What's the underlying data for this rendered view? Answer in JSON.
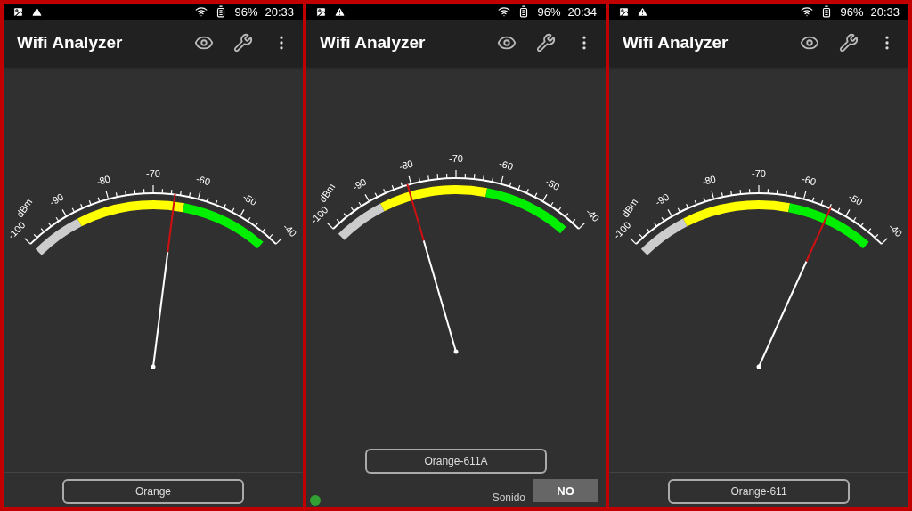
{
  "panels": [
    {
      "status_bar": {
        "battery": "96%",
        "time": "20:33"
      },
      "title": "Wifi Analyzer",
      "gauge": {
        "unit": "dBm",
        "scale": [
          "-100",
          "-90",
          "-80",
          "-70",
          "-60",
          "-50",
          "-40"
        ]
      },
      "network": {
        "name": "Orange"
      }
    },
    {
      "status_bar": {
        "battery": "96%",
        "time": "20:34"
      },
      "title": "Wifi Analyzer",
      "gauge": {
        "unit": "dBm",
        "scale": [
          "-100",
          "-90",
          "-80",
          "-70",
          "-60",
          "-50",
          "-40"
        ]
      },
      "network": {
        "name": "Orange-611A"
      },
      "sound": {
        "label": "Sonido",
        "button": "NO"
      }
    },
    {
      "status_bar": {
        "battery": "96%",
        "time": "20:33"
      },
      "title": "Wifi Analyzer",
      "gauge": {
        "unit": "dBm",
        "scale": [
          "-100",
          "-90",
          "-80",
          "-70",
          "-60",
          "-50",
          "-40"
        ]
      },
      "network": {
        "name": "Orange-611"
      }
    }
  ]
}
